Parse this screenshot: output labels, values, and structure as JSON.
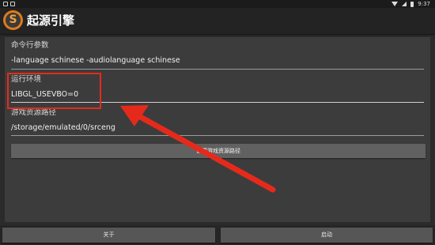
{
  "status_bar": {
    "time": "9:37"
  },
  "app_bar": {
    "logo_letter": "S",
    "title": "起源引擎"
  },
  "fields": [
    {
      "label": "命令行参数",
      "value": "-language schinese -audiolanguage schinese"
    },
    {
      "label": "运行环境",
      "value": "LIBGL_USEVBO=0"
    },
    {
      "label": "游戏资源路径",
      "value": "/storage/emulated/0/srceng"
    }
  ],
  "path_button_label": "设置游戏资源路径",
  "bottom_bar": {
    "about_label": "关于",
    "launch_label": "启动"
  },
  "annotation": {
    "color": "#e52a1c"
  },
  "colors": {
    "accent": "#e07b1c",
    "background": "#3c3c3c"
  }
}
